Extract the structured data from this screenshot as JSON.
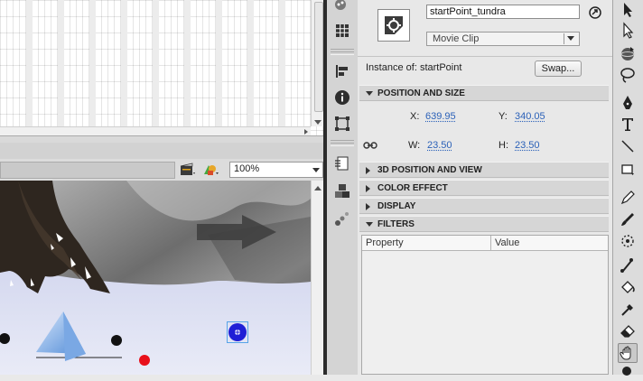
{
  "editbar": {
    "zoom": "100%"
  },
  "properties": {
    "instance_name": "startPoint_tundra",
    "symbol_type": "Movie Clip",
    "instance_of_label": "Instance of:",
    "instance_of_value": "startPoint",
    "swap_label": "Swap...",
    "sections": {
      "position_size": "POSITION AND SIZE",
      "position_3d": "3D POSITION AND VIEW",
      "color_effect": "COLOR EFFECT",
      "display": "DISPLAY",
      "filters": "FILTERS"
    },
    "x_label": "X:",
    "x_value": "639.95",
    "y_label": "Y:",
    "y_value": "340.05",
    "w_label": "W:",
    "w_value": "23.50",
    "h_label": "H:",
    "h_value": "23.50",
    "filters_columns": [
      "Property",
      "Value"
    ]
  },
  "colors": {
    "selection_blue": "#1f1fd6",
    "marker_red": "#e8101a",
    "link_blue": "#2b61b8"
  },
  "icons": {
    "strip": [
      "color-swatches-icon",
      "align-grid-icon",
      "align-icon",
      "info-icon",
      "transform-icon",
      "code-snippets-icon",
      "components-icon",
      "motion-presets-icon"
    ],
    "tools": [
      "selection-arrow-icon",
      "subselection-arrow-icon",
      "3d-rotation-icon",
      "lasso-icon",
      "pen-icon",
      "text-icon",
      "line-icon",
      "rectangle-icon",
      "pencil-icon",
      "brush-icon",
      "deco-icon",
      "bone-icon",
      "paint-bucket-icon",
      "eyedropper-icon",
      "eraser-icon",
      "hand-icon",
      "zoom-icon"
    ]
  }
}
